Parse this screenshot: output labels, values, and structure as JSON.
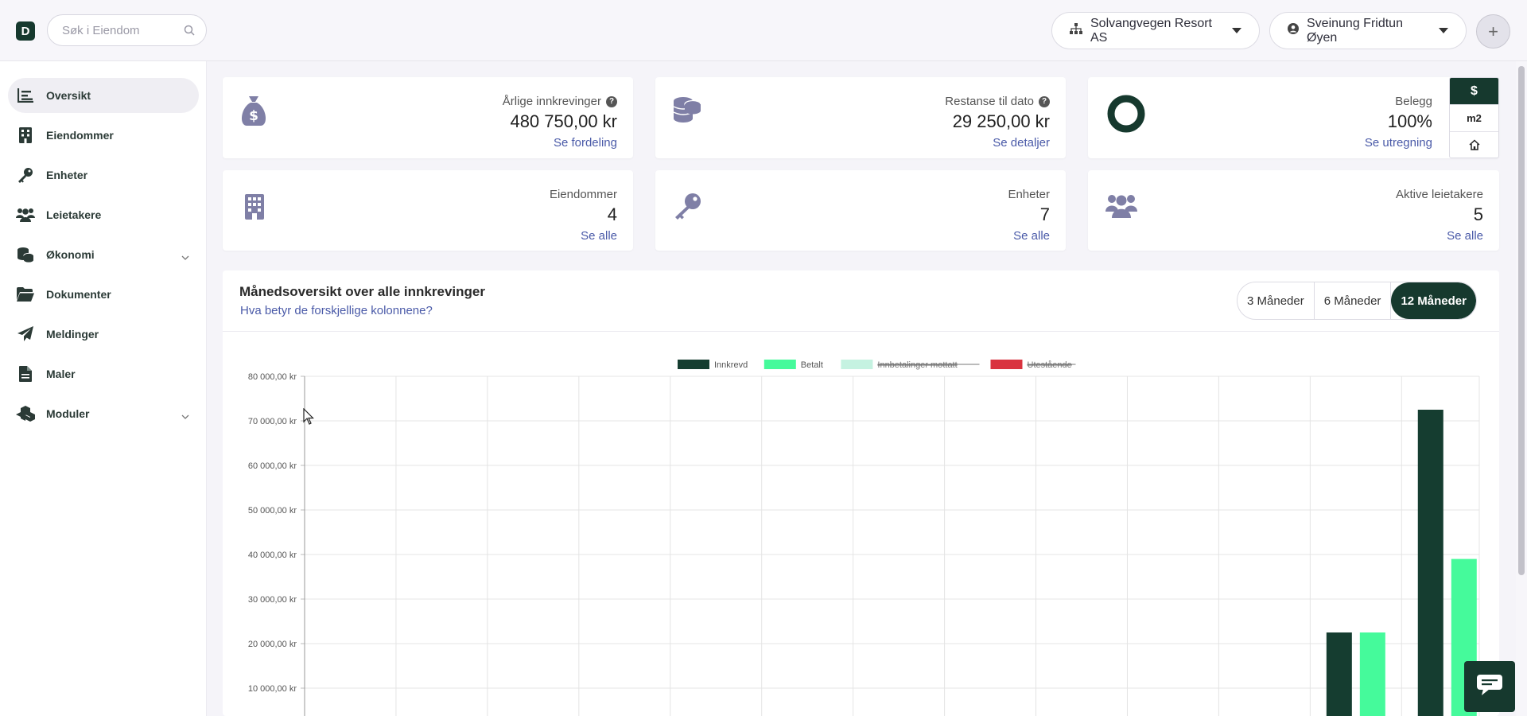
{
  "header": {
    "logo_letter": "D",
    "search_placeholder": "Søk i Eiendom",
    "organization": "Solvangvegen Resort AS",
    "user": "Sveinung Fridtun Øyen",
    "add_symbol": "+"
  },
  "sidebar": {
    "items": [
      {
        "label": "Oversikt",
        "icon": "chart-list-icon"
      },
      {
        "label": "Eiendommer",
        "icon": "building-icon"
      },
      {
        "label": "Enheter",
        "icon": "key-icon"
      },
      {
        "label": "Leietakere",
        "icon": "users-icon"
      },
      {
        "label": "Økonomi",
        "icon": "coins-icon"
      },
      {
        "label": "Dokumenter",
        "icon": "folder-icon"
      },
      {
        "label": "Meldinger",
        "icon": "paper-plane-icon"
      },
      {
        "label": "Maler",
        "icon": "file-icon"
      },
      {
        "label": "Moduler",
        "icon": "cubes-icon"
      }
    ]
  },
  "cards": {
    "annual": {
      "label": "Årlige innkrevinger",
      "value": "480 750,00 kr",
      "link": "Se fordeling"
    },
    "arrears": {
      "label": "Restanse til dato",
      "value": "29 250,00 kr",
      "link": "Se detaljer"
    },
    "occupancy": {
      "label": "Belegg",
      "value": "100%",
      "link": "Se utregning",
      "fill_fraction": 1.0
    },
    "properties": {
      "label": "Eiendommer",
      "value": "4",
      "link": "Se alle"
    },
    "units": {
      "label": "Enheter",
      "value": "7",
      "link": "Se alle"
    },
    "tenants": {
      "label": "Aktive leietakere",
      "value": "5",
      "link": "Se alle"
    }
  },
  "unit_toggle": {
    "options": [
      "$",
      "m2"
    ],
    "selected": "$"
  },
  "chart_panel": {
    "title": "Månedsoversikt over alle innkrevinger",
    "help_link": "Hva betyr de forskjellige kolonnene?",
    "ranges": [
      "3 Måneder",
      "6 Måneder",
      "12 Måneder"
    ],
    "selected_range": "12 Måneder"
  },
  "colors": {
    "brand": "#16392e",
    "innkrevd": "#153d30",
    "betalt": "#45fa9b",
    "innbetalinger": "#c5f2e1",
    "utestaende": "#d9333f",
    "link": "#4a5aa8",
    "icon_muted": "#7f7fa6"
  },
  "chart_data": {
    "type": "bar",
    "categories": [
      "",
      "",
      "",
      "",
      "",
      "",
      "",
      "",
      "",
      "",
      "",
      "",
      ""
    ],
    "series": [
      {
        "name": "Innkrevd",
        "values": [
          0,
          0,
          0,
          0,
          0,
          0,
          0,
          0,
          0,
          0,
          0,
          22500,
          72500
        ],
        "hidden": false
      },
      {
        "name": "Betalt",
        "values": [
          0,
          0,
          0,
          0,
          0,
          0,
          0,
          0,
          0,
          0,
          0,
          22500,
          39000
        ],
        "hidden": false
      },
      {
        "name": "Innbetalinger mottatt",
        "values": [],
        "hidden": true
      },
      {
        "name": "Utestående",
        "values": [],
        "hidden": true
      }
    ],
    "yticks": [
      "80 000,00 kr",
      "70 000,00 kr",
      "60 000,00 kr",
      "50 000,00 kr",
      "40 000,00 kr",
      "30 000,00 kr",
      "20 000,00 kr",
      "10 000,00 kr"
    ],
    "ylim": [
      0,
      80000
    ],
    "grid": true,
    "legend_position": "top-center"
  }
}
